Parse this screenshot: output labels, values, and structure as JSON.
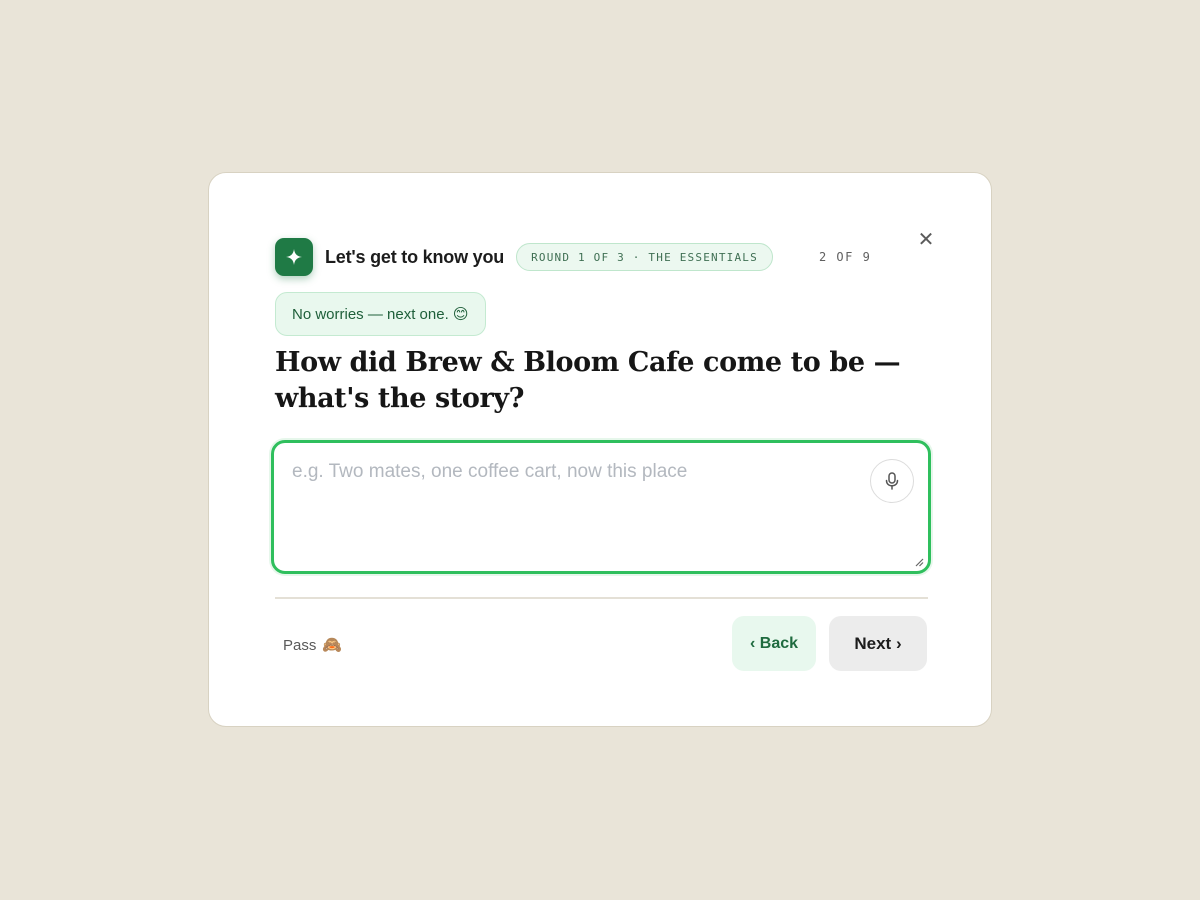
{
  "header": {
    "title": "Let's get to know you",
    "round_label": "ROUND 1 OF 3 · THE ESSENTIALS",
    "counter": "2 OF 9"
  },
  "toast": {
    "text": "No worries — next one.",
    "emoji": "😊"
  },
  "question": {
    "text": "How did Brew & Bloom Cafe come to be — what's the story?"
  },
  "answer": {
    "value": "",
    "placeholder": "e.g. Two mates, one coffee cart, now this place"
  },
  "footer": {
    "pass_label": "Pass",
    "pass_emoji": "🙈",
    "back_label": "‹ Back",
    "next_label": "Next ›"
  },
  "icons": {
    "logo": "sparkle-icon",
    "close": "close-icon",
    "mic": "microphone-icon",
    "resize": "resize-grip-icon"
  },
  "colors": {
    "accent": "#1f7a45",
    "focus_ring": "#2fbf5d",
    "page_background": "#e9e4d8"
  }
}
